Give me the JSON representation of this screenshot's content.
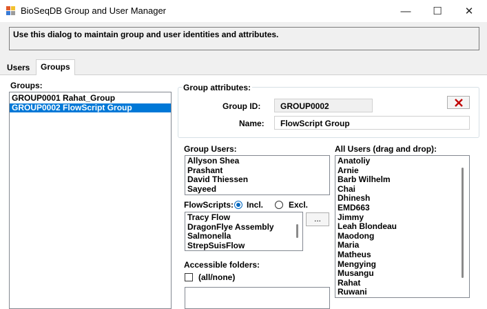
{
  "window": {
    "title": "BioSeqDB Group and User Manager",
    "minimize_glyph": "—",
    "maximize_glyph": "☐",
    "close_glyph": "✕"
  },
  "info": {
    "text": "Use this dialog to maintain group and user identities and attributes."
  },
  "tabs": [
    {
      "label": "Users",
      "active": false
    },
    {
      "label": "Groups",
      "active": true
    }
  ],
  "groups": {
    "label": "Groups:",
    "items": [
      {
        "text": "GROUP0001 Rahat_Group",
        "selected": false
      },
      {
        "text": "GROUP0002 FlowScript Group",
        "selected": true
      }
    ]
  },
  "attributes": {
    "label": "Group attributes:",
    "group_id_label": "Group ID:",
    "group_id_value": "GROUP0002",
    "name_label": "Name:",
    "name_value": "FlowScript Group",
    "delete_icon": "red-x-icon",
    "delete_color": "#c00000"
  },
  "group_users": {
    "label": "Group Users:",
    "items": [
      "Allyson Shea",
      "Prashant",
      "David Thiessen",
      "Sayeed"
    ]
  },
  "flowscripts": {
    "label": "FlowScripts:",
    "incl_label": "Incl.",
    "excl_label": "Excl.",
    "selected": "Incl.",
    "items": [
      "Tracy Flow",
      "DragonFlye Assembly",
      "Salmonella",
      "StrepSuisFlow"
    ],
    "browse_label": "..."
  },
  "folders": {
    "label": "Accessible folders:",
    "all_none_label": "(all/none)"
  },
  "all_users": {
    "label": "All Users (drag and drop):",
    "items": [
      "Anatoliy",
      "Arnie",
      "Barb Wilhelm",
      "Chai",
      "Dhinesh",
      "EMD663",
      "Jimmy",
      "Leah Blondeau",
      "Maodong",
      "Maria",
      "Matheus",
      "Mengying",
      "Musangu",
      "Rahat",
      "Ruwani"
    ]
  },
  "colors": {
    "selection": "#0078d7",
    "accent": "#0067c0"
  }
}
